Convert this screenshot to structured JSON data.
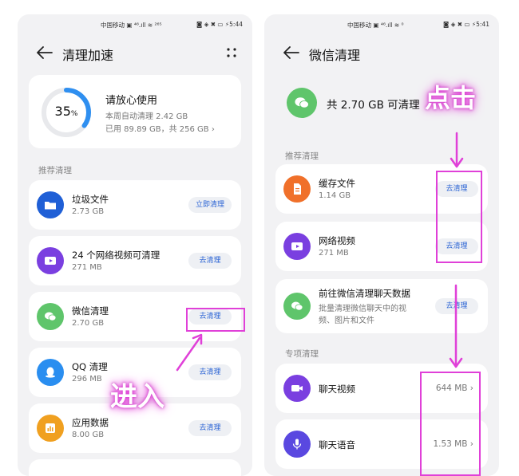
{
  "left": {
    "status": {
      "carrier": "中国移动 ▣ ⁴⁶.ıll ≋ ²⁶⁵",
      "right": "◙ ◈ ✖ ▭ ⚡5:44"
    },
    "title": "清理加速",
    "summary": {
      "percent": "35",
      "percent_unit": "%",
      "headline": "请放心使用",
      "week": "本周自动清理 2.42 GB",
      "used": "已用 89.89 GB，共 256 GB ›",
      "ring_fraction": 0.35
    },
    "section": "推荐清理",
    "items": [
      {
        "title": "垃圾文件",
        "sub": "2.73 GB",
        "button": "立即清理"
      },
      {
        "title": "24 个网络视频可清理",
        "sub": "271 MB",
        "button": "去清理"
      },
      {
        "title": "微信清理",
        "sub": "2.70 GB",
        "button": "去清理"
      },
      {
        "title": "QQ 清理",
        "sub": "296 MB",
        "button": "去清理"
      },
      {
        "title": "应用数据",
        "sub": "8.00 GB",
        "button": "去清理"
      }
    ],
    "annotation": "进入"
  },
  "right": {
    "status": {
      "carrier": "中国移动 ▣ ⁴⁶.ıll ≋ ⁰",
      "right": "◙ ◈ ✖ ▭ ⚡5:41"
    },
    "title": "微信清理",
    "summary": "共 2.70 GB 可清理",
    "section1": "推荐清理",
    "items": [
      {
        "title": "缓存文件",
        "sub": "1.14 GB",
        "button": "去清理"
      },
      {
        "title": "网络视频",
        "sub": "271 MB",
        "button": "去清理"
      },
      {
        "title": "前往微信清理聊天数据",
        "sub1": "批量清理微信聊天中的视",
        "sub2": "频、图片和文件",
        "button": "去清理"
      }
    ],
    "section2": "专项清理",
    "special": [
      {
        "title": "聊天视频",
        "value": "644 MB ›"
      },
      {
        "title": "聊天语音",
        "value": "1.53 MB ›"
      }
    ],
    "annotation": "点击"
  },
  "colors": {
    "accent_blue": "#2a63d4",
    "ring": "#2f8ff0",
    "annotation": "#e040d8",
    "wechat_green": "#5fc56b"
  },
  "icons": [
    "back-arrow-icon",
    "more-icon",
    "folder-icon",
    "video-icon",
    "wechat-icon",
    "qq-icon",
    "chart-icon",
    "document-icon",
    "camera-icon",
    "microphone-icon"
  ]
}
